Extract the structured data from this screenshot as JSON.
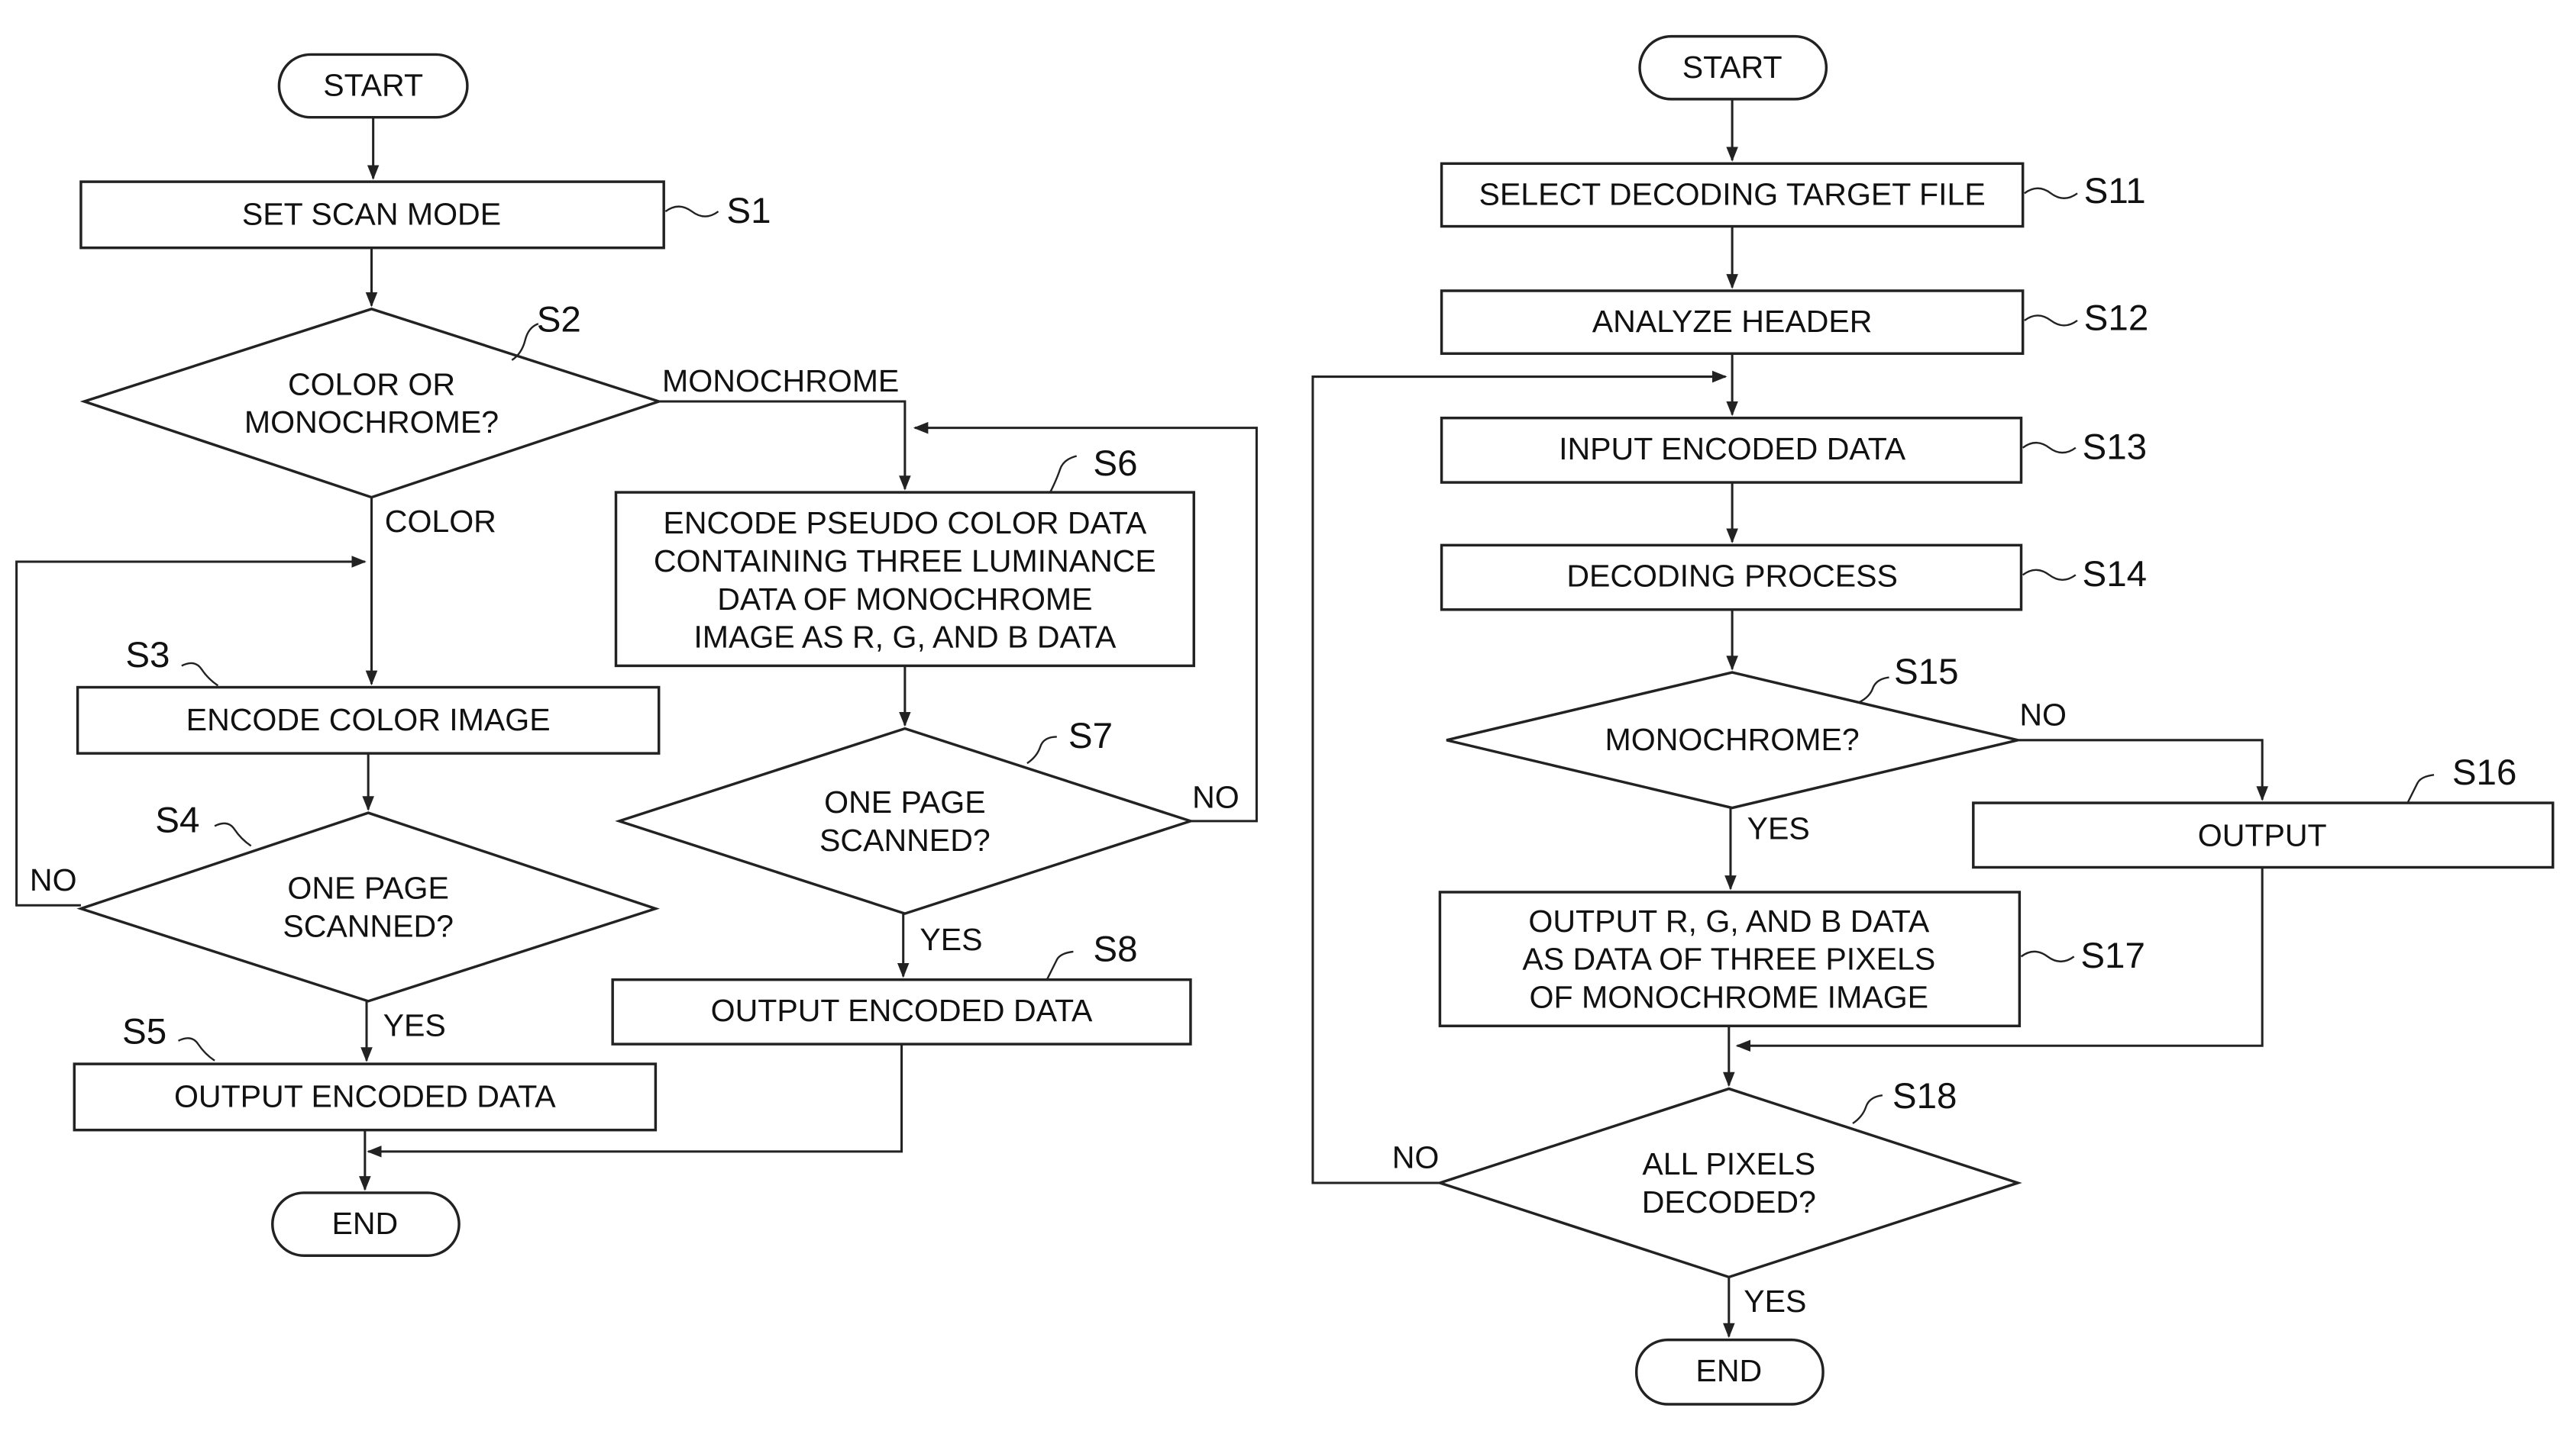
{
  "figure": {
    "left_flow": {
      "start": "START",
      "end": "END",
      "steps": {
        "s1": {
          "label": "S1",
          "lines": [
            "SET SCAN MODE"
          ]
        },
        "s2": {
          "label": "S2",
          "lines": [
            "COLOR OR",
            "MONOCHROME?"
          ]
        },
        "s3": {
          "label": "S3",
          "lines": [
            "ENCODE COLOR IMAGE"
          ]
        },
        "s4": {
          "label": "S4",
          "lines": [
            "ONE PAGE",
            "SCANNED?"
          ]
        },
        "s5": {
          "label": "S5",
          "lines": [
            "OUTPUT ENCODED DATA"
          ]
        },
        "s6": {
          "label": "S6",
          "lines": [
            "ENCODE PSEUDO COLOR DATA",
            "CONTAINING THREE LUMINANCE",
            "DATA OF MONOCHROME",
            "IMAGE AS R, G, AND B DATA"
          ]
        },
        "s7": {
          "label": "S7",
          "lines": [
            "ONE PAGE",
            "SCANNED?"
          ]
        },
        "s8": {
          "label": "S8",
          "lines": [
            "OUTPUT ENCODED DATA"
          ]
        }
      },
      "branches": {
        "s2_monochrome": "MONOCHROME",
        "s2_color": "COLOR",
        "s4_no": "NO",
        "s4_yes": "YES",
        "s7_no": "NO",
        "s7_yes": "YES"
      }
    },
    "right_flow": {
      "start": "START",
      "end": "END",
      "steps": {
        "s11": {
          "label": "S11",
          "lines": [
            "SELECT DECODING TARGET FILE"
          ]
        },
        "s12": {
          "label": "S12",
          "lines": [
            "ANALYZE HEADER"
          ]
        },
        "s13": {
          "label": "S13",
          "lines": [
            "INPUT ENCODED DATA"
          ]
        },
        "s14": {
          "label": "S14",
          "lines": [
            "DECODING PROCESS"
          ]
        },
        "s15": {
          "label": "S15",
          "lines": [
            "MONOCHROME?"
          ]
        },
        "s16": {
          "label": "S16",
          "lines": [
            "OUTPUT"
          ]
        },
        "s17": {
          "label": "S17",
          "lines": [
            "OUTPUT R, G, AND B DATA",
            "AS DATA OF THREE PIXELS",
            "OF MONOCHROME IMAGE"
          ]
        },
        "s18": {
          "label": "S18",
          "lines": [
            "ALL PIXELS",
            "DECODED?"
          ]
        }
      },
      "branches": {
        "s15_no": "NO",
        "s15_yes": "YES",
        "s18_no": "NO",
        "s18_yes": "YES"
      }
    }
  }
}
